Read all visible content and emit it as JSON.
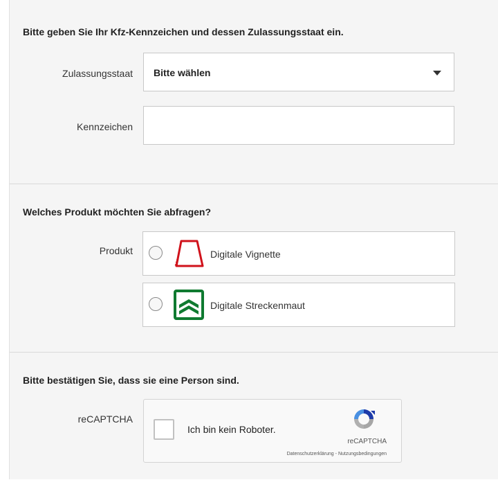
{
  "vehicle_section": {
    "heading": "Bitte geben Sie Ihr Kfz-Kennzeichen und dessen Zulassungsstaat ein.",
    "country_label": "Zulassungsstaat",
    "country_value": "Bitte wählen",
    "plate_label": "Kennzeichen",
    "plate_value": ""
  },
  "product_section": {
    "heading": "Welches Produkt möchten Sie abfragen?",
    "label": "Produkt",
    "options": [
      {
        "label": "Digitale Vignette",
        "icon": "vignette-icon",
        "color": "#d0121b"
      },
      {
        "label": "Digitale Streckenmaut",
        "icon": "streckenmaut-icon",
        "color": "#0f7a30"
      }
    ]
  },
  "captcha_section": {
    "heading": "Bitte bestätigen Sie, dass sie eine Person sind.",
    "label": "reCAPTCHA",
    "checkbox_text": "Ich bin kein Roboter.",
    "brand": "reCAPTCHA",
    "privacy_link": "Datenschutzerklärung",
    "separator": " - ",
    "terms_link": "Nutzungsbedingungen"
  }
}
